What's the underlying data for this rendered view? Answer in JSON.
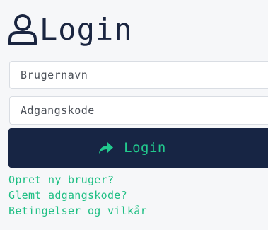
{
  "header": {
    "icon": "user-icon",
    "title": "Login"
  },
  "form": {
    "username_placeholder": "Brugernavn",
    "username_value": "",
    "password_placeholder": "Adgangskode",
    "password_value": ""
  },
  "login_button": {
    "icon": "share-arrow-icon",
    "label": "Login"
  },
  "links": {
    "create_account": "Opret ny bruger?",
    "forgot_password": "Glemt adgangskode?",
    "terms": "Betingelser og vilkår"
  },
  "colors": {
    "navy": "#172544",
    "accent_green": "#1fbf84",
    "background": "#f6f7f9"
  }
}
